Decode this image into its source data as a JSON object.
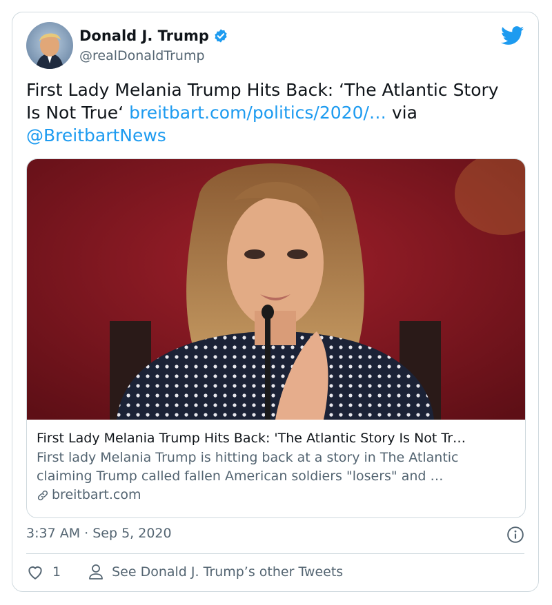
{
  "author": {
    "name": "Donald J. Trump",
    "handle": "@realDonaldTrump",
    "verified": true
  },
  "tweet": {
    "text_before_link": "First Lady Melania Trump Hits Back: ‘The Atlantic Story Is Not True‘ ",
    "link": "breitbart.com/politics/2020/…",
    "text_via": " via ",
    "mention": "@BreitbartNews"
  },
  "card": {
    "title": "First Lady Melania Trump Hits Back: 'The Atlantic Story Is Not Tr…",
    "description_line1": "First lady Melania Trump is hitting back at a story in The Atlantic",
    "description_line2": "claiming Trump called fallen American soldiers \"losers\" and …",
    "domain": "breitbart.com",
    "image": "photo of woman in polka-dot blouse with hands clasped in front of microphone"
  },
  "meta": {
    "timestamp": "3:37 AM · Sep 5, 2020"
  },
  "actions": {
    "like_count": "1",
    "other_tweets_label": "See Donald J. Trump’s other Tweets"
  },
  "colors": {
    "link": "#1d9bf0",
    "secondary_text": "#536471",
    "border": "#cfd9de",
    "twitter_blue": "#1d9bf0"
  },
  "icons": [
    "twitter-bird-icon",
    "verified-badge-icon",
    "link-icon",
    "info-icon",
    "heart-icon",
    "person-icon"
  ]
}
